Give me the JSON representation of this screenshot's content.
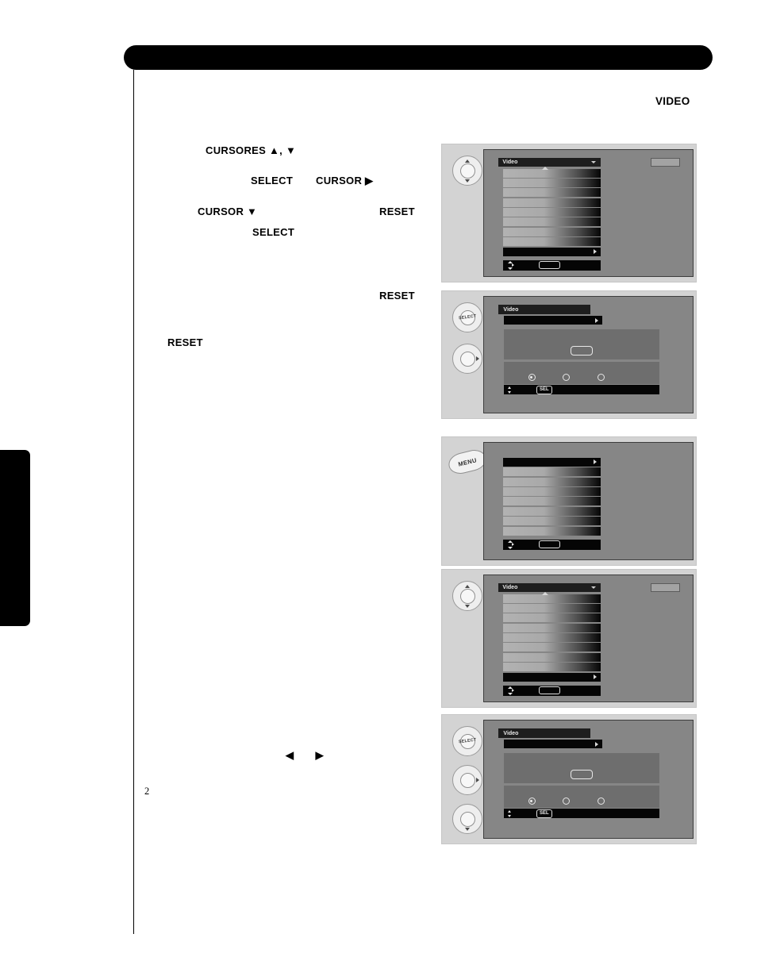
{
  "page": {
    "number": "2",
    "heading_keyword": "VIDEO"
  },
  "instructions": {
    "cursores": "CURSORES  ▲, ▼",
    "select_1": "SELECT",
    "cursor_right": "CURSOR ▶",
    "cursor_down": "CURSOR ▼",
    "reset_1": "RESET",
    "select_2": "SELECT",
    "reset_2": "RESET",
    "reset_3": "RESET",
    "lr_arrows": "◀ ▶"
  },
  "panels": [
    {
      "id": "panel-video-main-1",
      "type": "main-menu",
      "buttons": [
        {
          "name": "cursor-up-down-button",
          "label": ""
        }
      ],
      "osd": {
        "title": "Video",
        "rows": 9,
        "selected_row_index": 8,
        "has_corner_button": true,
        "has_scroll_up_arrow": true,
        "footer": {
          "glyph": "up-down-right",
          "pill": ""
        }
      }
    },
    {
      "id": "panel-video-sub-1",
      "type": "sub-menu",
      "buttons": [
        {
          "name": "select-button",
          "label": "SELECT"
        },
        {
          "name": "cursor-right-button",
          "label": ""
        }
      ],
      "osd": {
        "title": "Video",
        "radios": 3,
        "selected_radio_index": 0,
        "footer": {
          "glyph": "up-down",
          "sel_label": "SEL"
        }
      }
    },
    {
      "id": "panel-menu",
      "type": "main-menu-nohdr",
      "buttons": [
        {
          "name": "menu-button",
          "label": "MENU"
        }
      ],
      "osd": {
        "title": "",
        "rows": 9,
        "selected_row_index": 0,
        "has_corner_button": false,
        "has_scroll_up_arrow": false,
        "footer": {
          "glyph": "up-down-right",
          "pill": ""
        }
      }
    },
    {
      "id": "panel-video-main-2",
      "type": "main-menu",
      "buttons": [
        {
          "name": "cursor-up-down-button",
          "label": ""
        }
      ],
      "osd": {
        "title": "Video",
        "rows": 9,
        "selected_row_index": 8,
        "has_corner_button": true,
        "has_scroll_up_arrow": true,
        "footer": {
          "glyph": "up-down-right",
          "pill": ""
        }
      }
    },
    {
      "id": "panel-video-sub-2",
      "type": "sub-menu",
      "buttons": [
        {
          "name": "select-button",
          "label": "SELECT"
        },
        {
          "name": "cursor-right-button",
          "label": ""
        },
        {
          "name": "cursor-down-button",
          "label": ""
        }
      ],
      "osd": {
        "title": "Video",
        "radios": 3,
        "selected_radio_index": 0,
        "footer": {
          "glyph": "up-down",
          "sel_label": "SEL"
        }
      }
    }
  ],
  "colors": {
    "page_bg": "#ffffff",
    "bar_black": "#000000",
    "panel_bg": "#d3d3d3",
    "tv_bg": "#868686",
    "osd_dark": "#1e1e1e"
  }
}
